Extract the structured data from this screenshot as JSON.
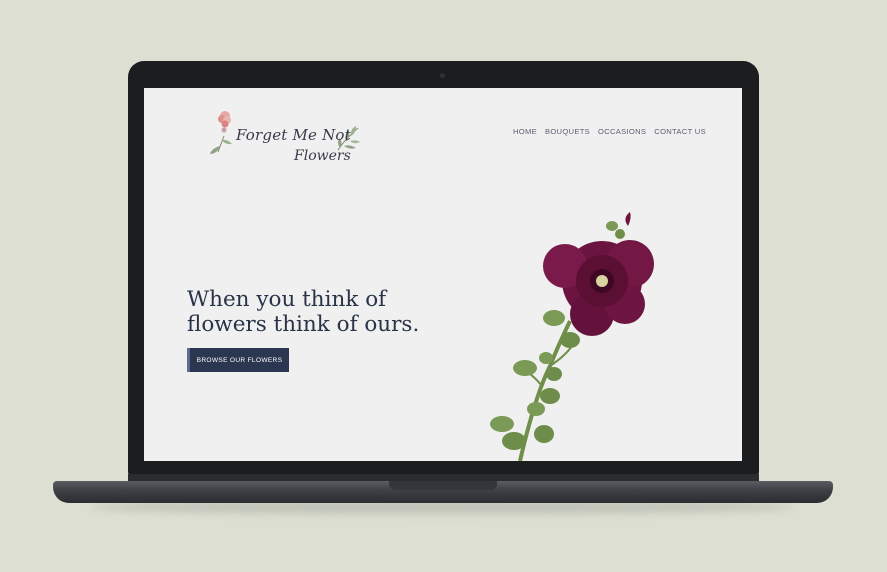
{
  "brand": {
    "line1": "Forget Me Not",
    "line2": "Flowers"
  },
  "nav": {
    "items": [
      "HOME",
      "BOUQUETS",
      "OCCASIONS",
      "CONTACT US"
    ]
  },
  "hero": {
    "title_line1": "When you think of",
    "title_line2": "flowers think of ours.",
    "cta_label": "BROWSE OUR FLOWERS"
  },
  "colors": {
    "backdrop": "#dcdfd2",
    "screen_bg": "#f0f0f0",
    "heading": "#283347",
    "button": "#2b3650",
    "flower": "#6b1440"
  }
}
